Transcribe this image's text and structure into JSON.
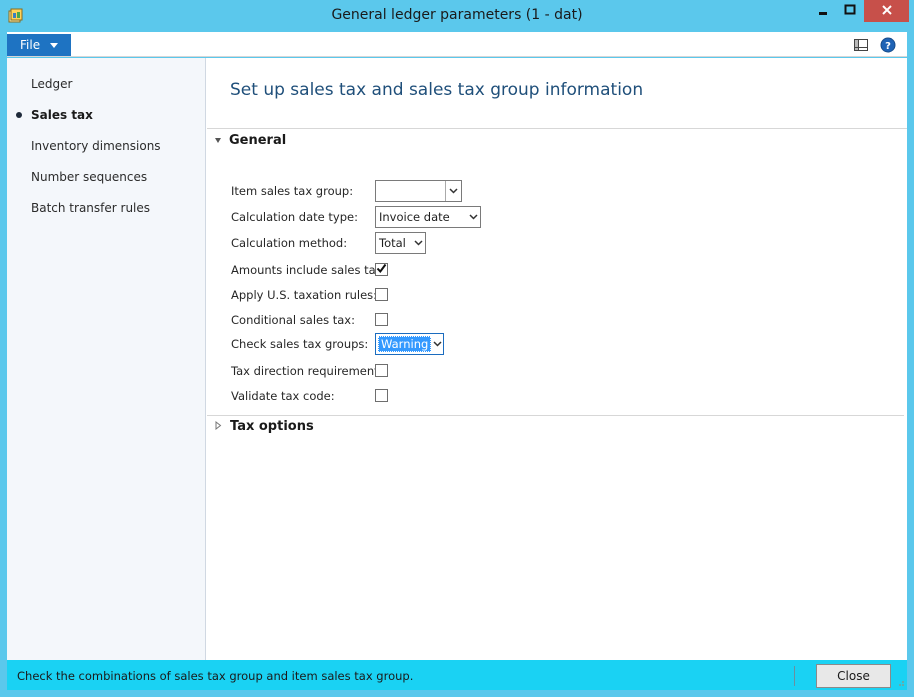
{
  "window": {
    "title": "General ledger parameters (1 - dat)",
    "controls": [
      "minimize-icon",
      "maximize-icon",
      "close-icon"
    ]
  },
  "menubar": {
    "file_label": "File",
    "right_icons": [
      "layout-icon",
      "help-icon"
    ]
  },
  "sidebar": {
    "items": [
      {
        "label": "Ledger",
        "active": false
      },
      {
        "label": "Sales tax",
        "active": true
      },
      {
        "label": "Inventory dimensions",
        "active": false
      },
      {
        "label": "Number sequences",
        "active": false
      },
      {
        "label": "Batch transfer rules",
        "active": false
      }
    ]
  },
  "main": {
    "heading": "Set up sales tax and sales tax group information",
    "general": {
      "title": "General",
      "expanded": true,
      "fields": {
        "item_sales_tax_group": {
          "label": "Item sales tax group:",
          "value": ""
        },
        "calculation_date_type": {
          "label": "Calculation date type:",
          "value": "Invoice date"
        },
        "calculation_method": {
          "label": "Calculation method:",
          "value": "Total"
        },
        "amounts_include_sales_tax": {
          "label": "Amounts include sales tax:",
          "checked": true
        },
        "apply_us_taxation_rules": {
          "label": "Apply U.S. taxation rules:",
          "checked": false
        },
        "conditional_sales_tax": {
          "label": "Conditional sales tax:",
          "checked": false
        },
        "check_sales_tax_groups": {
          "label": "Check sales tax groups:",
          "value": "Warning"
        },
        "tax_direction_requirement": {
          "label": "Tax direction requirement:",
          "checked": false
        },
        "validate_tax_code": {
          "label": "Validate tax code:",
          "checked": false
        }
      }
    },
    "tax_options": {
      "title": "Tax options",
      "expanded": false
    }
  },
  "statusbar": {
    "message": "Check the combinations of sales tax group and item sales tax group.",
    "close_label": "Close"
  },
  "colors": {
    "titlebar": "#5bc8ec",
    "statusbar": "#1ad2f3",
    "file_button": "#1e73c2",
    "heading": "#1f4f7a",
    "close_button": "#c7504a",
    "selection": "#3399ff"
  }
}
